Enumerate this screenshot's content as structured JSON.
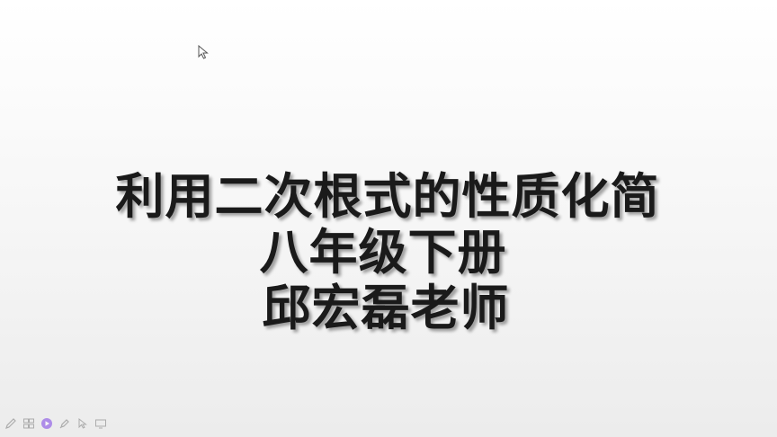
{
  "slide": {
    "title_line_1": "利用二次根式的性质化简",
    "title_line_2": "八年级下册",
    "title_line_3": "邱宏磊老师"
  },
  "toolbar": {
    "icons": [
      "pen-icon",
      "slides-grid-icon",
      "play-icon",
      "highlighter-icon",
      "pointer-icon",
      "screen-icon"
    ]
  },
  "colors": {
    "title_text": "#1a1a1a",
    "play_accent": "#7b3fe4"
  }
}
